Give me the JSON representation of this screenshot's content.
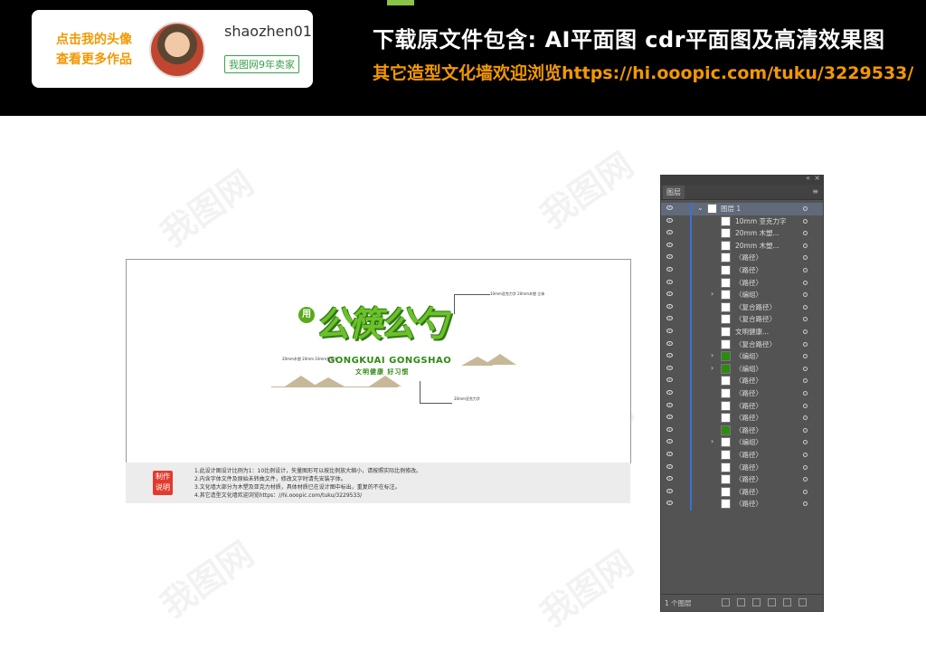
{
  "banner": {
    "author_cta_line1": "点击我的头像",
    "author_cta_line2": "查看更多作品",
    "author_name": "shaozhen01",
    "seller_badge": "我图网9年卖家",
    "headline": "下载原文件包含:  AI平面图  cdr平面图及高清效果图",
    "subline": "其它造型文化墙欢迎浏览https://hi.ooopic.com/tuku/3229533/"
  },
  "artwork": {
    "circle_text": "用",
    "title": "公筷公勺",
    "pinyin": "GONGKUAI GONGSHAO",
    "slogan": "文明健康  好习惯",
    "note_top": "10mm亚克力字 20mm木塑 立体",
    "note_left": "20mm木塑 20mm 10mm亚克力",
    "note_bottom": "20mm亚克力字"
  },
  "instructions": {
    "stamp_line1": "制作",
    "stamp_line2": "说明",
    "lines": [
      "1.此设计图设计比例为1：10比例设计，矢量图形可以按比例放大缩小，请按照实际比例修改。",
      "2.内含字体文件及原始未转曲文件，修改文字时请先安装字体。",
      "3.文化墙大部分为木塑及亚克力材质，具体材质已在设计图中标出，重复的不在标注。",
      "4.其它造型文化墙欢迎浏览https：//hi.ooopic.com/tuku/3229533/"
    ]
  },
  "layers_panel": {
    "tab_label": "图层",
    "collapse_icon": "«",
    "close_icon": "×",
    "menu_icon": "≡",
    "top_layer": "图层 1",
    "layer_count": "1 个图层",
    "items": [
      {
        "label": "10mm 亚克力字",
        "expandable": false,
        "thumb": "white"
      },
      {
        "label": "20mm 木塑...",
        "expandable": false,
        "thumb": "white"
      },
      {
        "label": "20mm 木塑...",
        "expandable": false,
        "thumb": "white"
      },
      {
        "label": "〈路径〉",
        "expandable": false,
        "thumb": "white"
      },
      {
        "label": "〈路径〉",
        "expandable": false,
        "thumb": "white"
      },
      {
        "label": "〈路径〉",
        "expandable": false,
        "thumb": "white"
      },
      {
        "label": "〈编组〉",
        "expandable": true,
        "thumb": "white"
      },
      {
        "label": "〈复合路径〉",
        "expandable": false,
        "thumb": "white"
      },
      {
        "label": "〈复合路径〉",
        "expandable": false,
        "thumb": "white"
      },
      {
        "label": "文明健康...",
        "expandable": false,
        "thumb": "white"
      },
      {
        "label": "〈复合路径〉",
        "expandable": false,
        "thumb": "white"
      },
      {
        "label": "〈编组〉",
        "expandable": true,
        "thumb": "green"
      },
      {
        "label": "〈编组〉",
        "expandable": true,
        "thumb": "green"
      },
      {
        "label": "〈路径〉",
        "expandable": false,
        "thumb": "white"
      },
      {
        "label": "〈路径〉",
        "expandable": false,
        "thumb": "white"
      },
      {
        "label": "〈路径〉",
        "expandable": false,
        "thumb": "white"
      },
      {
        "label": "〈路径〉",
        "expandable": false,
        "thumb": "white"
      },
      {
        "label": "〈路径〉",
        "expandable": false,
        "thumb": "green"
      },
      {
        "label": "〈编组〉",
        "expandable": true,
        "thumb": "white"
      },
      {
        "label": "〈路径〉",
        "expandable": false,
        "thumb": "white"
      },
      {
        "label": "〈路径〉",
        "expandable": false,
        "thumb": "white"
      },
      {
        "label": "〈路径〉",
        "expandable": false,
        "thumb": "white"
      },
      {
        "label": "〈路径〉",
        "expandable": false,
        "thumb": "white"
      },
      {
        "label": "〈路径〉",
        "expandable": false,
        "thumb": "white"
      }
    ]
  },
  "watermark_text": "我图网"
}
